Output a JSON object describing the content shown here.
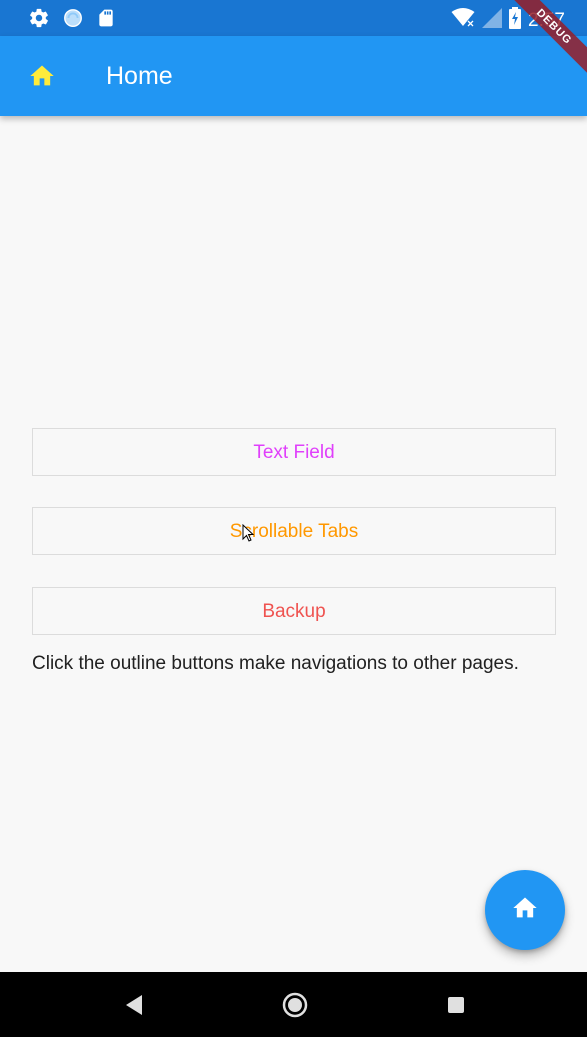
{
  "status_bar": {
    "time": "2:57",
    "icons": [
      "settings-icon",
      "sync-icon",
      "sd-card-icon",
      "wifi-icon",
      "cell-signal-icon",
      "battery-charging-icon"
    ],
    "background": "#1976d2"
  },
  "debug_banner": {
    "label": "DEBUG"
  },
  "app_bar": {
    "title": "Home",
    "icon": "home-icon",
    "background": "#2196f3",
    "icon_color": "#ffeb3b"
  },
  "main": {
    "buttons": [
      {
        "label": "Text Field",
        "color": "#e040fb"
      },
      {
        "label": "Scrollable Tabs",
        "color": "#ff9800"
      },
      {
        "label": "Backup",
        "color": "#ef5350"
      }
    ],
    "helper_text": "Click the outline buttons make navigations to other pages."
  },
  "fab": {
    "icon": "home-icon",
    "background": "#2196f3"
  },
  "nav_bar": {
    "items": [
      "back-icon",
      "home-circle-icon",
      "recents-icon"
    ]
  }
}
